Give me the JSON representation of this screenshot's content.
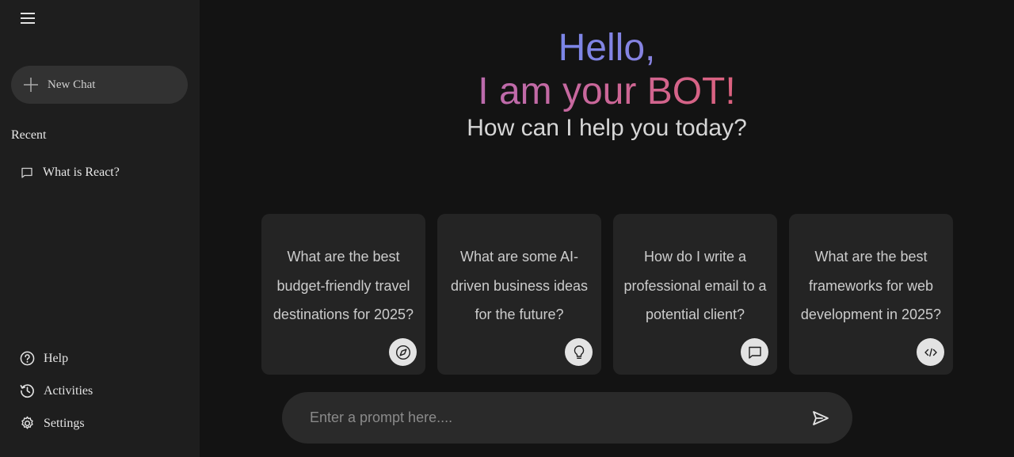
{
  "sidebar": {
    "new_chat_label": "New Chat",
    "recent_title": "Recent",
    "recent_items": [
      {
        "label": "What is React?",
        "icon": "message-icon"
      }
    ],
    "bottom_items": [
      {
        "label": "Help",
        "icon": "help-icon"
      },
      {
        "label": "Activities",
        "icon": "history-icon"
      },
      {
        "label": "Settings",
        "icon": "gear-icon"
      }
    ]
  },
  "main": {
    "greeting_line1": "Hello,",
    "greeting_line2": "I am your BOT!",
    "subtitle": "How can I help you today?",
    "cards": [
      {
        "text": "What are the best budget-friendly travel destinations for 2025?",
        "icon": "compass-icon"
      },
      {
        "text": "What are some AI-driven business ideas for the future?",
        "icon": "bulb-icon"
      },
      {
        "text": "How do I write a professional email to a potential client?",
        "icon": "message-icon"
      },
      {
        "text": "What are the best frameworks for web development in 2025?",
        "icon": "code-icon"
      }
    ],
    "prompt_placeholder": "Enter a prompt here...."
  },
  "colors": {
    "background": "#131313",
    "sidebar": "#1e1e1e",
    "card": "#242424",
    "gradient_blue": "#4b90ff",
    "gradient_red": "#ff5546"
  }
}
